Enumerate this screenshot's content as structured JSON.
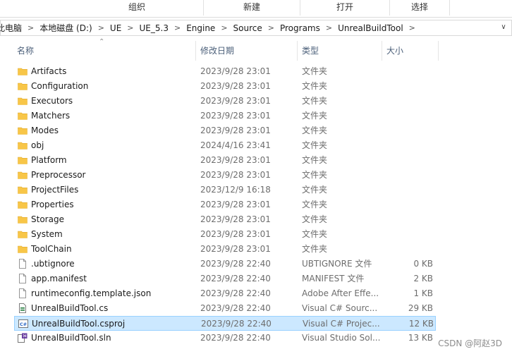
{
  "ribbon": {
    "groups": [
      "组织",
      "新建",
      "打开",
      "选择"
    ]
  },
  "address": {
    "crumbs": [
      "此电脑",
      "本地磁盘 (D:)",
      "UE",
      "UE_5.3",
      "Engine",
      "Source",
      "Programs",
      "UnrealBuildTool"
    ]
  },
  "columns": {
    "name": "名称",
    "date": "修改日期",
    "type": "类型",
    "size": "大小"
  },
  "files": [
    {
      "name": "Artifacts",
      "date": "2023/9/28 23:01",
      "type": "文件夹",
      "size": "",
      "icon": "folder-icon"
    },
    {
      "name": "Configuration",
      "date": "2023/9/28 23:01",
      "type": "文件夹",
      "size": "",
      "icon": "folder-icon"
    },
    {
      "name": "Executors",
      "date": "2023/9/28 23:01",
      "type": "文件夹",
      "size": "",
      "icon": "folder-icon"
    },
    {
      "name": "Matchers",
      "date": "2023/9/28 23:01",
      "type": "文件夹",
      "size": "",
      "icon": "folder-icon"
    },
    {
      "name": "Modes",
      "date": "2023/9/28 23:01",
      "type": "文件夹",
      "size": "",
      "icon": "folder-icon"
    },
    {
      "name": "obj",
      "date": "2024/4/16 23:41",
      "type": "文件夹",
      "size": "",
      "icon": "folder-icon"
    },
    {
      "name": "Platform",
      "date": "2023/9/28 23:01",
      "type": "文件夹",
      "size": "",
      "icon": "folder-icon"
    },
    {
      "name": "Preprocessor",
      "date": "2023/9/28 23:01",
      "type": "文件夹",
      "size": "",
      "icon": "folder-icon"
    },
    {
      "name": "ProjectFiles",
      "date": "2023/12/9 16:18",
      "type": "文件夹",
      "size": "",
      "icon": "folder-icon"
    },
    {
      "name": "Properties",
      "date": "2023/9/28 23:01",
      "type": "文件夹",
      "size": "",
      "icon": "folder-icon"
    },
    {
      "name": "Storage",
      "date": "2023/9/28 23:01",
      "type": "文件夹",
      "size": "",
      "icon": "folder-icon"
    },
    {
      "name": "System",
      "date": "2023/9/28 23:01",
      "type": "文件夹",
      "size": "",
      "icon": "folder-icon"
    },
    {
      "name": "ToolChain",
      "date": "2023/9/28 23:01",
      "type": "文件夹",
      "size": "",
      "icon": "folder-icon"
    },
    {
      "name": ".ubtignore",
      "date": "2023/9/28 22:40",
      "type": "UBTIGNORE 文件",
      "size": "0 KB",
      "icon": "file-icon"
    },
    {
      "name": "app.manifest",
      "date": "2023/9/28 22:40",
      "type": "MANIFEST 文件",
      "size": "2 KB",
      "icon": "file-icon"
    },
    {
      "name": "runtimeconfig.template.json",
      "date": "2023/9/28 22:40",
      "type": "Adobe After Effe...",
      "size": "1 KB",
      "icon": "file-icon"
    },
    {
      "name": "UnrealBuildTool.cs",
      "date": "2023/9/28 22:40",
      "type": "Visual C# Sourc...",
      "size": "29 KB",
      "icon": "csharp-file-icon"
    },
    {
      "name": "UnrealBuildTool.csproj",
      "date": "2023/9/28 22:40",
      "type": "Visual C# Projec...",
      "size": "12 KB",
      "icon": "csproj-file-icon",
      "selected": true
    },
    {
      "name": "UnrealBuildTool.sln",
      "date": "2023/9/28 22:40",
      "type": "Visual Studio Sol...",
      "size": "13 KB",
      "icon": "sln-file-icon"
    }
  ],
  "watermark": "CSDN @阿赵3D",
  "colors": {
    "folder": "#f8c648",
    "folder_dark": "#e0a92b",
    "selection_bg": "#cce8ff",
    "selection_border": "#99d1ff",
    "header_text": "#4c607a",
    "csproj_accent": "#2b66c4",
    "sln_accent": "#6a3fa0"
  }
}
